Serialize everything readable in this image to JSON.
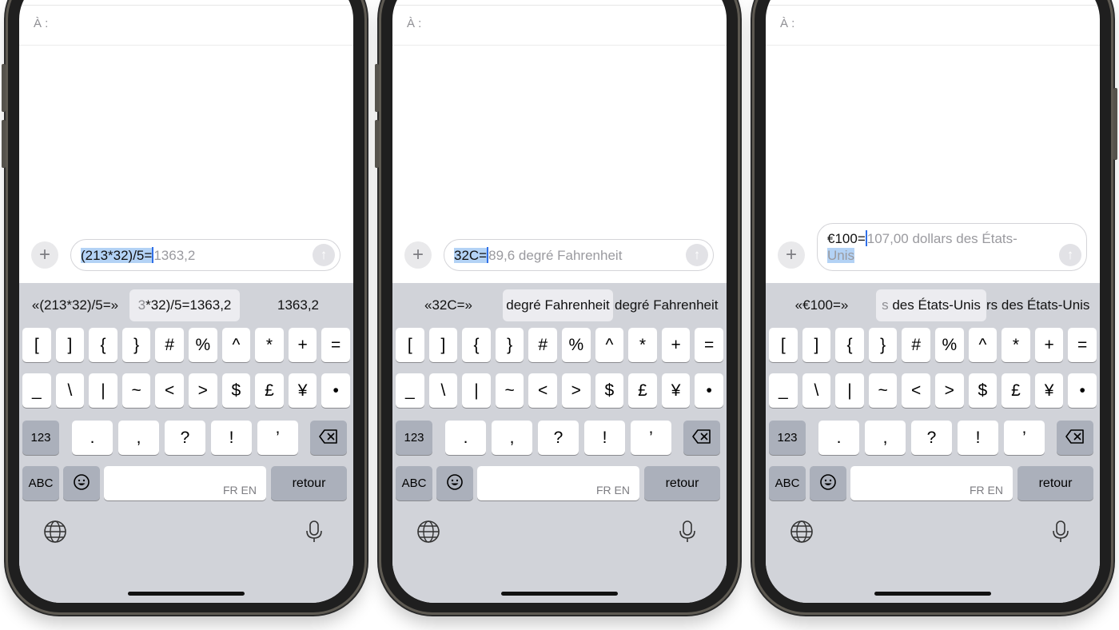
{
  "common": {
    "to_label": "À :",
    "plus_icon": "+",
    "send_icon": "↑",
    "keyboard": {
      "row1": [
        "[",
        "]",
        "{",
        "}",
        "#",
        "%",
        "^",
        "*",
        "+",
        "="
      ],
      "row2": [
        "_",
        "\\",
        "|",
        "~",
        "<",
        ">",
        "$",
        "£",
        "¥",
        "•"
      ],
      "row3": [
        ".",
        ",",
        "?",
        "!",
        "’"
      ],
      "key_123": "123",
      "key_abc": "ABC",
      "space_lang": "FR EN",
      "return_label": "retour",
      "emoji_icon": "emoji-icon",
      "globe_icon": "globe-icon",
      "mic_icon": "microphone-icon",
      "delete_icon": "delete-icon"
    }
  },
  "phones": [
    {
      "field_selected": "(213*32)/5=",
      "field_ghost": "1363,2",
      "sugg_left": "«(213*32)/5=»",
      "sugg_mid_dim": "3",
      "sugg_mid": "*32)/5=1363,2",
      "sugg_right": "1363,2"
    },
    {
      "field_selected": "32C=",
      "field_ghost": "89,6 degré Fahrenheit",
      "sugg_left": "«32C=»",
      "sugg_mid": "degré Fahrenheit",
      "sugg_right": "degré Fahrenheit"
    },
    {
      "field_typed": "€100=",
      "field_ghost": "107,00 dollars des États-",
      "field_selected_line2": "Unis",
      "sugg_left": "«€100=»",
      "sugg_mid_dim": "s ",
      "sugg_mid": "des États-Unis",
      "sugg_right": "rs des États-Unis"
    }
  ]
}
